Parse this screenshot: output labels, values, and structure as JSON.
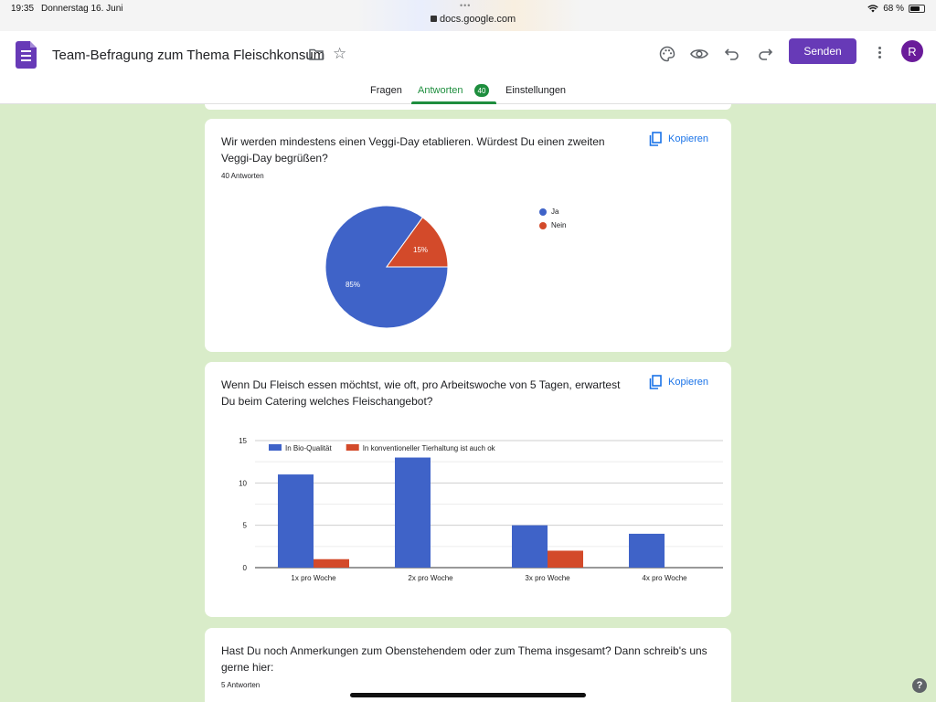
{
  "status_bar": {
    "time": "19:35",
    "date": "Donnerstag 16. Juni",
    "url": "docs.google.com",
    "battery": "68 %",
    "battery_level": 0.68
  },
  "header": {
    "title": "Team-Befragung zum Thema Fleischkonsum",
    "send_label": "Senden",
    "avatar_letter": "R",
    "accent": "#673ab7"
  },
  "tabs": [
    {
      "label": "Fragen"
    },
    {
      "label": "Antworten",
      "badge": "40"
    },
    {
      "label": "Einstellungen"
    }
  ],
  "cards": [
    {
      "question": "Wir werden mindestens einen Veggi-Day etablieren. Würdest Du einen zweiten Veggi-Day begrüßen?",
      "count": "40 Antworten",
      "copy_label": "Kopieren"
    },
    {
      "question": "Wenn Du Fleisch essen möchtst, wie oft, pro Arbeitswoche von 5 Tagen, erwartest Du beim Catering welches Fleischangebot?",
      "copy_label": "Kopieren"
    },
    {
      "question": "Hast Du noch Anmerkungen zum Obenstehendem oder zum Thema insgesamt? Dann schreib's uns gerne hier:",
      "count": "5 Antworten"
    }
  ],
  "chart_data": [
    {
      "type": "pie",
      "labels": [
        "Ja",
        "Nein"
      ],
      "values": [
        85,
        15
      ],
      "value_labels": [
        "85%",
        "15%"
      ],
      "colors": [
        "#3f63c8",
        "#d34a2a"
      ],
      "legend": "right"
    },
    {
      "type": "bar",
      "categories": [
        "1x pro Woche",
        "2x pro Woche",
        "3x pro Woche",
        "4x pro Woche"
      ],
      "series": [
        {
          "name": "In Bio-Qualität",
          "values": [
            11,
            13,
            5,
            4
          ],
          "color": "#3f63c8"
        },
        {
          "name": "In konventioneller Tierhaltung ist auch ok",
          "values": [
            1,
            0,
            2,
            0
          ],
          "color": "#d34a2a"
        }
      ],
      "ylim": [
        0,
        15
      ],
      "yticks": [
        0,
        5,
        10,
        15
      ],
      "legend": "top",
      "grid": true
    }
  ],
  "help": "?"
}
